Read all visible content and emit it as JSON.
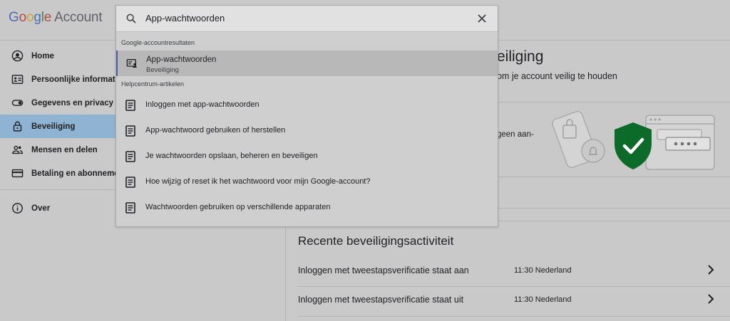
{
  "header": {
    "logo_text": "Google",
    "logo_suffix": "Account"
  },
  "sidebar": {
    "items": [
      {
        "label": "Home",
        "icon": "account-circle-icon"
      },
      {
        "label": "Persoonlijke informatie",
        "icon": "id-card-icon"
      },
      {
        "label": "Gegevens en privacy",
        "icon": "toggle-icon"
      },
      {
        "label": "Beveiliging",
        "icon": "lock-icon",
        "active": true
      },
      {
        "label": "Mensen en delen",
        "icon": "people-icon"
      },
      {
        "label": "Betaling en abonnementen",
        "icon": "credit-card-icon"
      }
    ],
    "footer_items": [
      {
        "label": "Over",
        "icon": "info-icon"
      }
    ]
  },
  "search": {
    "value": "App-wachtwoorden",
    "account_results_label": "Google-accountresultaten",
    "account_results": [
      {
        "title": "App-wachtwoorden",
        "subtitle": "Beveiliging"
      }
    ],
    "help_label": "Helpcentrum-artikelen",
    "help_articles": [
      "Inloggen met app-wachtwoorden",
      "App-wachtwoord gebruiken of herstellen",
      "Je wachtwoorden opslaan, beheren en beveiligen",
      "Hoe wijzig of reset ik het wachtwoord voor mijn Google-account?",
      "Wachtwoorden gebruiken op verschillende apparaten"
    ]
  },
  "main": {
    "title_visible": "eiliging",
    "subtitle_visible": "om je account veilig te houden",
    "card_text_visible": "geen aan-",
    "recent_title": "Recente beveiligingsactiviteit",
    "activities": [
      {
        "text": "Inloggen met tweestapsverificatie staat aan",
        "time": "11:30 Nederland"
      },
      {
        "text": "Inloggen met tweestapsverificatie staat uit",
        "time": "11:30 Nederland"
      }
    ]
  },
  "colors": {
    "active_nav": "#8fb3d3",
    "shield": "#0d6b2a",
    "highlight_border": "#4a5fa8"
  }
}
